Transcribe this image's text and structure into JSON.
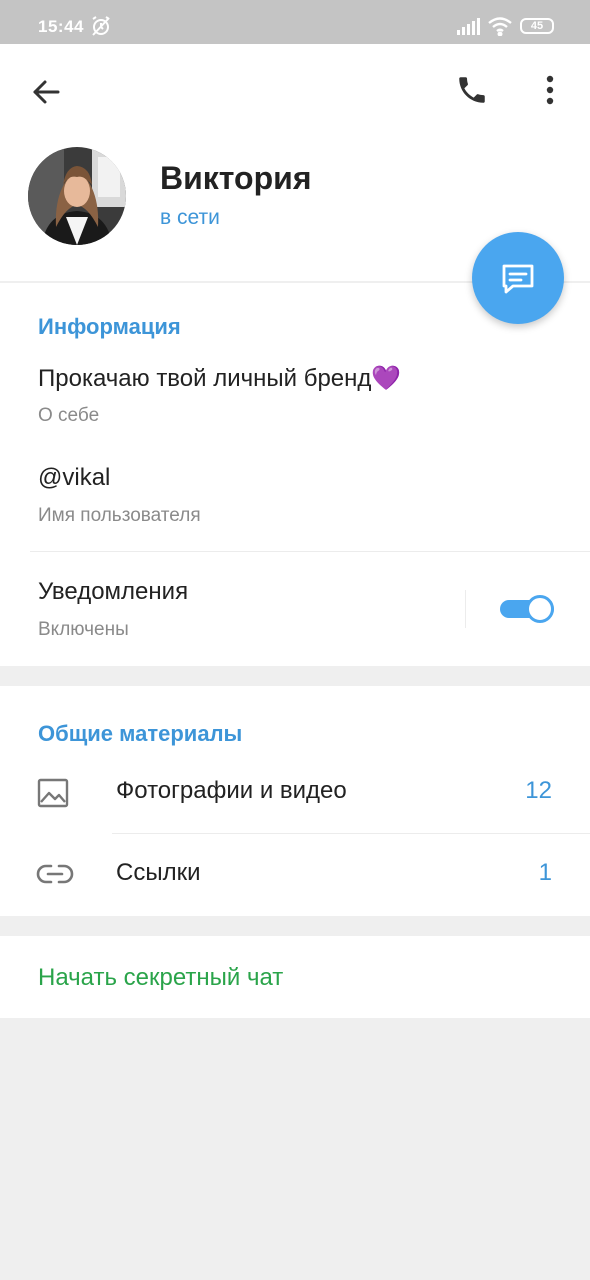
{
  "status_bar": {
    "time": "15:44",
    "battery": "45",
    "alarm_icon": "alarm-off-icon",
    "signal_icon": "signal-icon",
    "wifi_icon": "wifi-icon"
  },
  "toolbar": {
    "back_icon": "arrow-left-icon",
    "call_icon": "phone-icon",
    "more_icon": "more-vertical-icon"
  },
  "profile": {
    "name": "Виктория",
    "status": "в сети",
    "fab_icon": "message-icon"
  },
  "info": {
    "title": "Информация",
    "bio": "Прокачаю твой личный бренд💜",
    "bio_label": "О себе",
    "username": "@vikal",
    "username_label": "Имя пользователя",
    "notifications": "Уведомления",
    "notifications_state": "Включены",
    "notifications_on": true
  },
  "media": {
    "title": "Общие материалы",
    "items": [
      {
        "label": "Фотографии и видео",
        "count": "12",
        "icon": "image-icon"
      },
      {
        "label": "Ссылки",
        "count": "1",
        "icon": "link-icon"
      }
    ]
  },
  "secret_chat": {
    "label": "Начать секретный чат"
  },
  "colors": {
    "accent": "#3d95d8",
    "fab": "#4aa6ef",
    "secret": "#2aa44a",
    "status_bar": "#c4c4c4",
    "background": "#efefef"
  }
}
